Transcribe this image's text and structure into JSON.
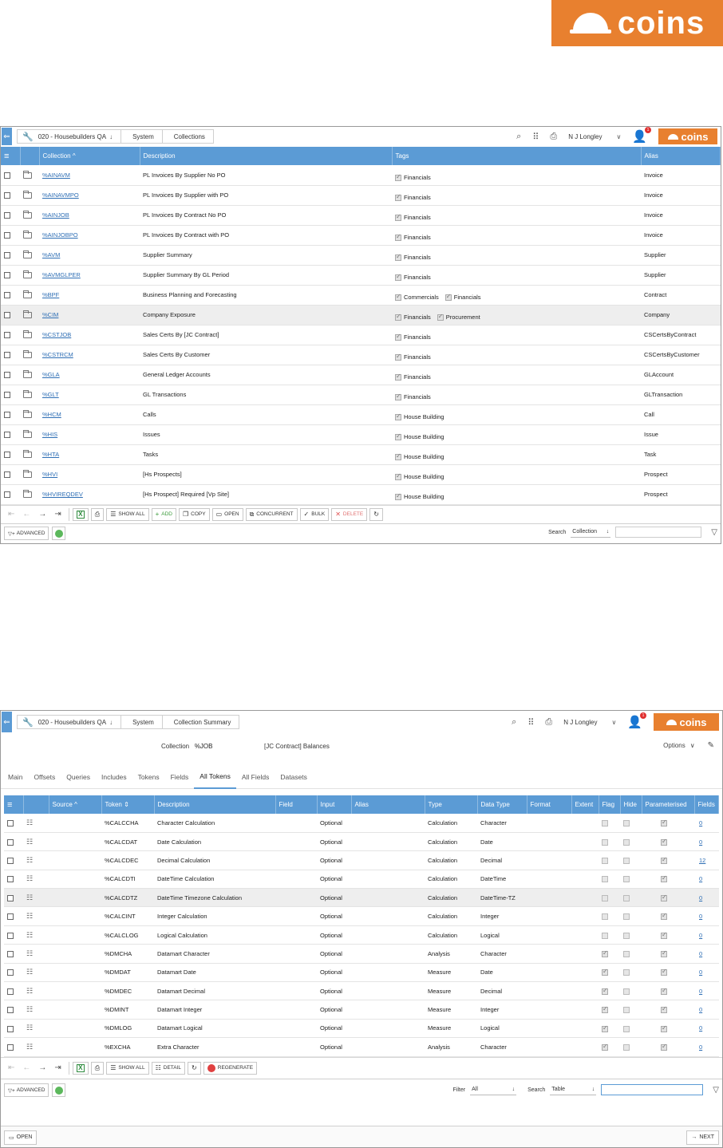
{
  "logo": {
    "text": "coins"
  },
  "colors": {
    "brand": "#e8802f",
    "header": "#5b9bd5",
    "link": "#2f6fb5"
  },
  "screen1": {
    "crumbs": [
      "020 - Housebuilders QA",
      "System",
      "Collections"
    ],
    "user": "N J Longley",
    "badge": "1",
    "mini_logo": "coins",
    "columns": {
      "collection": "Collection",
      "description": "Description",
      "tags": "Tags",
      "alias": "Alias"
    },
    "rows": [
      {
        "collection": "%AINAVM",
        "description": "PL Invoices By Supplier No PO",
        "tags": [
          "Financials"
        ],
        "alias": "Invoice"
      },
      {
        "collection": "%AINAVMPO",
        "description": "PL Invoices By Supplier with PO",
        "tags": [
          "Financials"
        ],
        "alias": "Invoice"
      },
      {
        "collection": "%AINJOB",
        "description": "PL Invoices By Contract No PO",
        "tags": [
          "Financials"
        ],
        "alias": "Invoice"
      },
      {
        "collection": "%AINJOBPO",
        "description": "PL Invoices By Contract with PO",
        "tags": [
          "Financials"
        ],
        "alias": "Invoice"
      },
      {
        "collection": "%AVM",
        "description": "Supplier Summary",
        "tags": [
          "Financials"
        ],
        "alias": "Supplier"
      },
      {
        "collection": "%AVMGLPER",
        "description": "Supplier Summary By GL Period",
        "tags": [
          "Financials"
        ],
        "alias": "Supplier"
      },
      {
        "collection": "%BPF",
        "description": "Business Planning and Forecasting",
        "tags": [
          "Commercials",
          "Financials"
        ],
        "alias": "Contract"
      },
      {
        "collection": "%CIM",
        "description": "Company Exposure",
        "tags": [
          "Financials",
          "Procurement"
        ],
        "alias": "Company",
        "selected": true
      },
      {
        "collection": "%CSTJOB",
        "description": "Sales Certs By [JC Contract]",
        "tags": [
          "Financials"
        ],
        "alias": "CSCertsByContract"
      },
      {
        "collection": "%CSTRCM",
        "description": "Sales Certs By Customer",
        "tags": [
          "Financials"
        ],
        "alias": "CSCertsByCustomer"
      },
      {
        "collection": "%GLA",
        "description": "General Ledger Accounts",
        "tags": [
          "Financials"
        ],
        "alias": "GLAccount"
      },
      {
        "collection": "%GLT",
        "description": "GL Transactions",
        "tags": [
          "Financials"
        ],
        "alias": "GLTransaction"
      },
      {
        "collection": "%HCM",
        "description": "Calls",
        "tags": [
          "House Building"
        ],
        "alias": "Call"
      },
      {
        "collection": "%HIS",
        "description": "Issues",
        "tags": [
          "House Building"
        ],
        "alias": "Issue"
      },
      {
        "collection": "%HTA",
        "description": "Tasks",
        "tags": [
          "House Building"
        ],
        "alias": "Task"
      },
      {
        "collection": "%HVI",
        "description": "[Hs Prospects]",
        "tags": [
          "House Building"
        ],
        "alias": "Prospect"
      },
      {
        "collection": "%HVIREQDEV",
        "description": "[Hs Prospect] Required [Vp Site]",
        "tags": [
          "House Building"
        ],
        "alias": "Prospect"
      }
    ],
    "toolbar": {
      "show_all": "SHOW ALL",
      "add": "ADD",
      "copy": "COPY",
      "open": "OPEN",
      "concurrent": "CONCURRENT",
      "bulk": "BULK",
      "delete": "DELETE"
    },
    "footer": {
      "advanced": "ADVANCED",
      "search_label": "Search",
      "search_field": "Collection"
    }
  },
  "screen2": {
    "crumbs": [
      "020 - Housebuilders QA",
      "System",
      "Collection Summary"
    ],
    "user": "N J Longley",
    "badge": "1",
    "mini_logo": "coins",
    "collection_label": "Collection",
    "collection_value": "%JOB",
    "collection_desc": "[JC Contract] Balances",
    "options": "Options",
    "tabs": [
      "Main",
      "Offsets",
      "Queries",
      "Includes",
      "Tokens",
      "Fields",
      "All Tokens",
      "All Fields",
      "Datasets"
    ],
    "active_tab": "All Tokens",
    "columns": {
      "source": "Source",
      "token": "Token",
      "description": "Description",
      "field": "Field",
      "input": "Input",
      "alias": "Alias",
      "type": "Type",
      "data_type": "Data Type",
      "format": "Format",
      "extent": "Extent",
      "flag": "Flag",
      "hide": "Hide",
      "parameterised": "Parameterised",
      "fields": "Fields"
    },
    "rows": [
      {
        "token": "%CALCCHA",
        "description": "Character Calculation",
        "input": "Optional",
        "type": "Calculation",
        "data_type": "Character",
        "flag": false,
        "fields": "0"
      },
      {
        "token": "%CALCDAT",
        "description": "Date Calculation",
        "input": "Optional",
        "type": "Calculation",
        "data_type": "Date",
        "flag": false,
        "fields": "0"
      },
      {
        "token": "%CALCDEC",
        "description": "Decimal Calculation",
        "input": "Optional",
        "type": "Calculation",
        "data_type": "Decimal",
        "flag": false,
        "fields": "12"
      },
      {
        "token": "%CALCDTI",
        "description": "DateTime Calculation",
        "input": "Optional",
        "type": "Calculation",
        "data_type": "DateTime",
        "flag": false,
        "fields": "0"
      },
      {
        "token": "%CALCDTZ",
        "description": "DateTime Timezone Calculation",
        "input": "Optional",
        "type": "Calculation",
        "data_type": "DateTime-TZ",
        "flag": false,
        "fields": "0",
        "selected": true
      },
      {
        "token": "%CALCINT",
        "description": "Integer Calculation",
        "input": "Optional",
        "type": "Calculation",
        "data_type": "Integer",
        "flag": false,
        "fields": "0"
      },
      {
        "token": "%CALCLOG",
        "description": "Logical Calculation",
        "input": "Optional",
        "type": "Calculation",
        "data_type": "Logical",
        "flag": false,
        "fields": "0"
      },
      {
        "token": "%DMCHA",
        "description": "Datamart Character",
        "input": "Optional",
        "type": "Analysis",
        "data_type": "Character",
        "flag": true,
        "fields": "0"
      },
      {
        "token": "%DMDAT",
        "description": "Datamart Date",
        "input": "Optional",
        "type": "Measure",
        "data_type": "Date",
        "flag": true,
        "fields": "0"
      },
      {
        "token": "%DMDEC",
        "description": "Datamart Decimal",
        "input": "Optional",
        "type": "Measure",
        "data_type": "Decimal",
        "flag": true,
        "fields": "0"
      },
      {
        "token": "%DMINT",
        "description": "Datamart Integer",
        "input": "Optional",
        "type": "Measure",
        "data_type": "Integer",
        "flag": true,
        "fields": "0"
      },
      {
        "token": "%DMLOG",
        "description": "Datamart Logical",
        "input": "Optional",
        "type": "Measure",
        "data_type": "Logical",
        "flag": true,
        "fields": "0"
      },
      {
        "token": "%EXCHA",
        "description": "Extra Character",
        "input": "Optional",
        "type": "Analysis",
        "data_type": "Character",
        "flag": true,
        "fields": "0"
      }
    ],
    "toolbar": {
      "show_all": "SHOW ALL",
      "detail": "DETAIL",
      "regenerate": "REGENERATE"
    },
    "footer": {
      "advanced": "ADVANCED",
      "filter_label": "Filter",
      "filter_value": "All",
      "search_label": "Search",
      "search_field": "Table"
    },
    "bottom": {
      "open": "OPEN",
      "next": "NEXT"
    }
  }
}
